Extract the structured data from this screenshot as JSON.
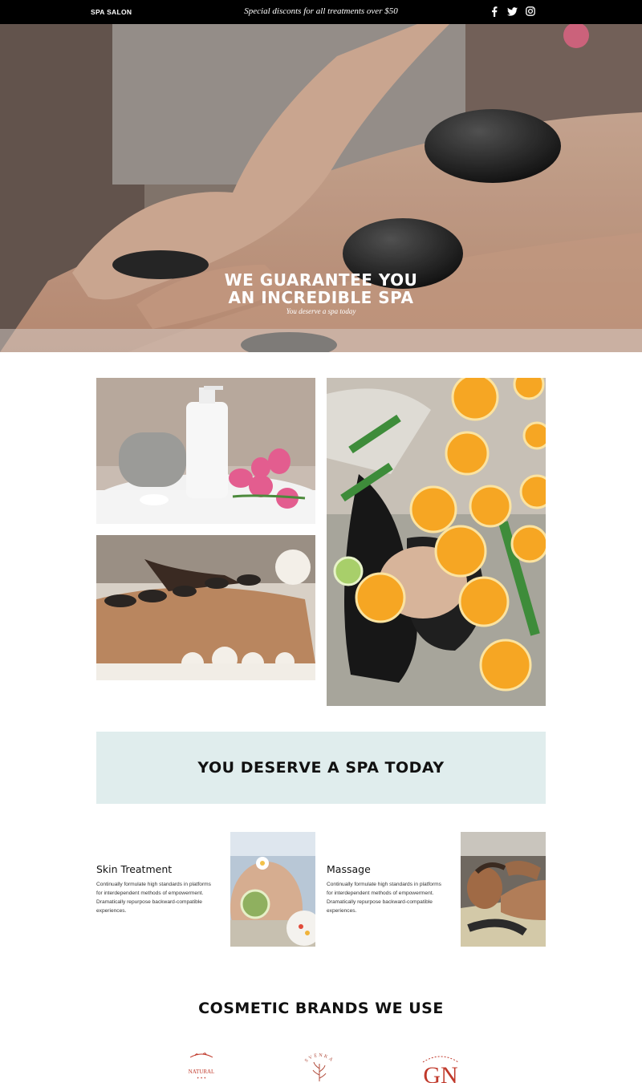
{
  "topbar": {
    "brand": "SPA SALON",
    "promo": "Special disconts for all treatments over $50",
    "social": [
      "facebook-icon",
      "twitter-icon",
      "instagram-icon"
    ]
  },
  "hero": {
    "title_line1": "WE GUARANTEE YOU",
    "title_line2": "AN INCREDIBLE SPA",
    "subtitle": "You deserve a spa today"
  },
  "banner": {
    "text": "YOU DESERVE A SPA TODAY",
    "background": "#e0eded"
  },
  "services": [
    {
      "title": "Skin Treatment",
      "description": "Continually formulate high standards in platforms for interdependent methods of empowerment. Dramatically repurpose backward-compatible experiences."
    },
    {
      "title": "Massage",
      "description": "Continually formulate high standards in platforms for interdependent methods of empowerment. Dramatically repurpose backward-compatible experiences."
    }
  ],
  "brands": {
    "title": "COSMETIC BRANDS WE USE",
    "logos": [
      {
        "name": "natural-logo",
        "text": "NATURAL"
      },
      {
        "name": "svenka-logo",
        "text": "SVENKA"
      },
      {
        "name": "gn-logo",
        "text": "GN"
      }
    ],
    "accent": "#c0392b"
  }
}
